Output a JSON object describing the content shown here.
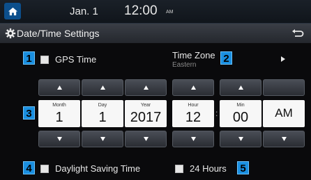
{
  "status": {
    "date": "Jan. 1",
    "time": "12:00",
    "ampm": "AM"
  },
  "header": {
    "title": "Date/Time Settings"
  },
  "markers": [
    "1",
    "2",
    "3",
    "4",
    "5"
  ],
  "gps": {
    "label": "GPS Time"
  },
  "timezone": {
    "label": "Time Zone",
    "value": "Eastern"
  },
  "date_fields": [
    {
      "label": "Month",
      "value": "1"
    },
    {
      "label": "Day",
      "value": "1"
    },
    {
      "label": "Year",
      "value": "2017"
    }
  ],
  "time_fields": [
    {
      "label": "Hour",
      "value": "12"
    },
    {
      "label": "Min",
      "value": "00"
    }
  ],
  "ampm_value": "AM",
  "dst": {
    "label": "Daylight Saving Time"
  },
  "hours24": {
    "label": "24 Hours"
  }
}
